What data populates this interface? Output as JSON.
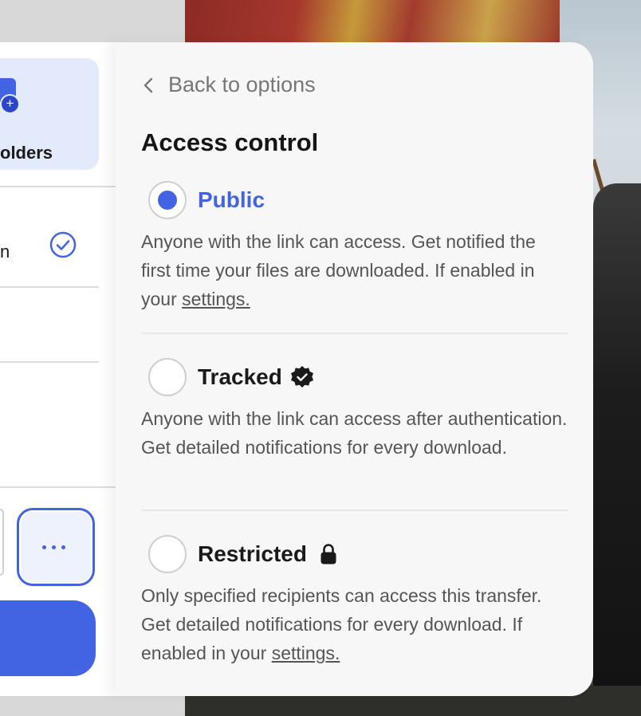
{
  "left_card": {
    "folders_label": "olders",
    "row_text": "n",
    "more_button_label": "More options"
  },
  "panel": {
    "back_label": "Back to options",
    "title": "Access control",
    "options": [
      {
        "label": "Public",
        "selected": true,
        "desc_text": "Anyone with the link can access. Get notified the first time your files are downloaded. If enabled in your ",
        "link": "settings."
      },
      {
        "label": "Tracked",
        "selected": false,
        "icon": "verified-badge-icon",
        "desc_text": "Anyone with the link can access after authentication. Get detailed notifications for every download."
      },
      {
        "label": "Restricted",
        "selected": false,
        "icon": "lock-icon",
        "desc_text": "Only specified recipients can access this transfer. Get detailed notifications for every download. If enabled in your ",
        "link": "settings."
      }
    ]
  },
  "colors": {
    "accent": "#4364e2",
    "panel_bg": "#f7f7f7",
    "tile_bg": "#e3eafc"
  }
}
